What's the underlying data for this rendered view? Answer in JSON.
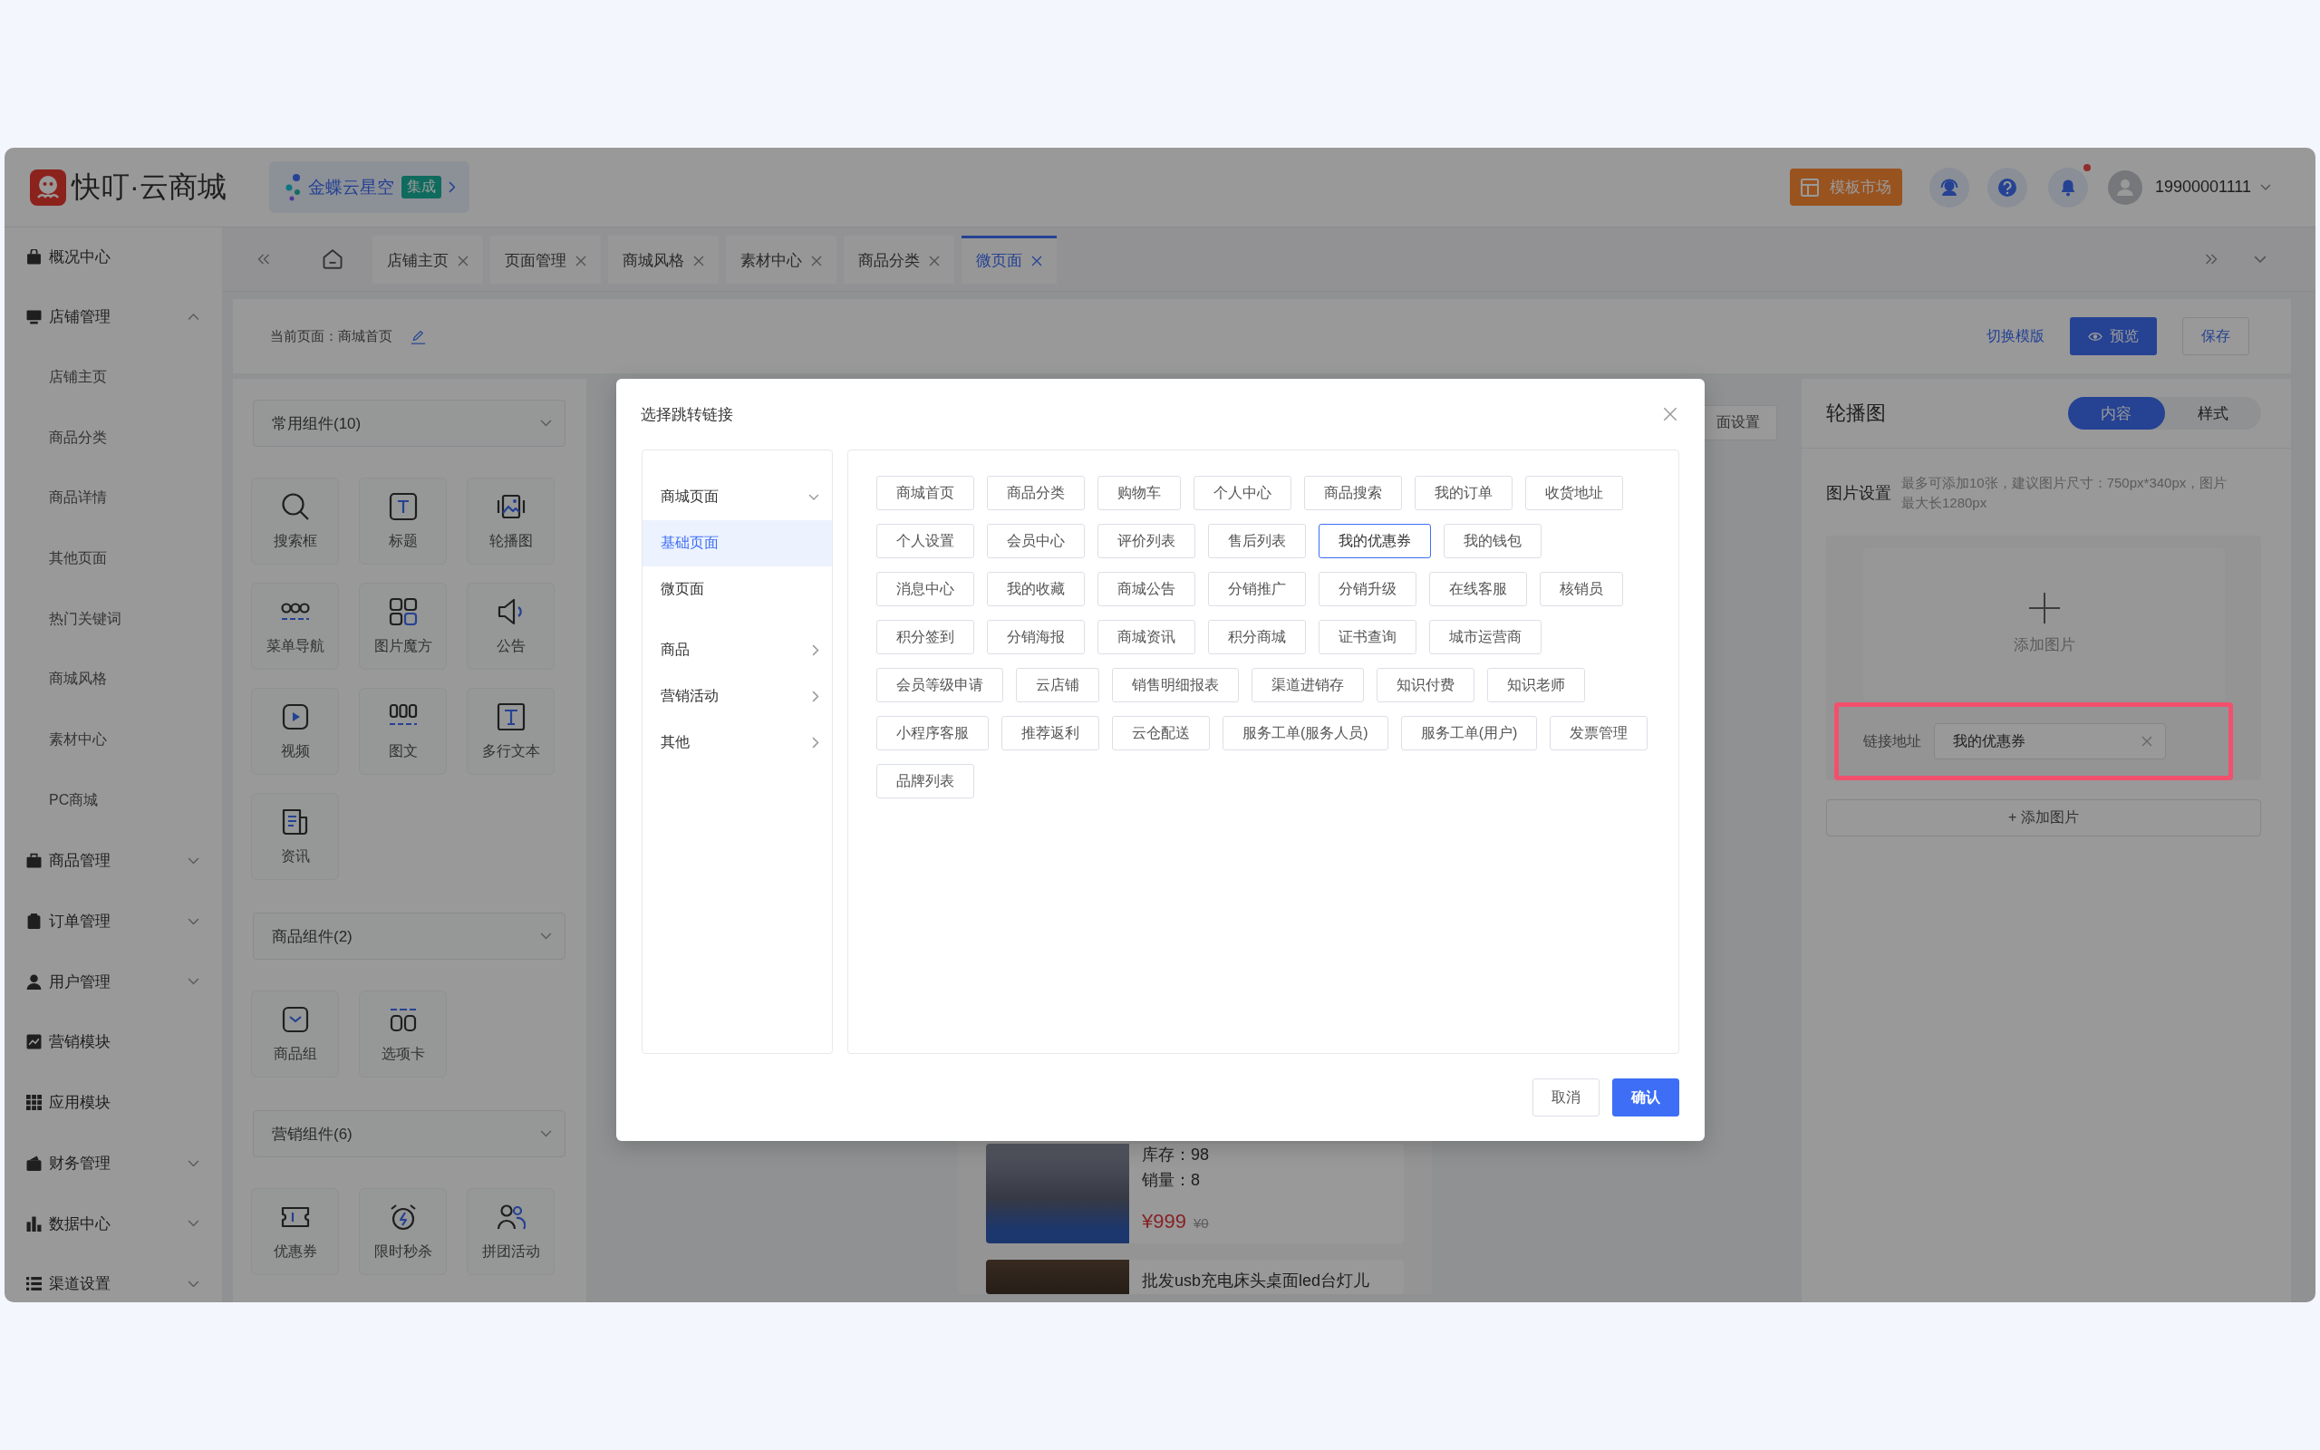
{
  "header": {
    "logo_text": "快叮·云商城",
    "integration": {
      "name": "金蝶云星空",
      "tag": "集成"
    },
    "template_market": "模板市场",
    "has_notification": true,
    "username": "19900001111"
  },
  "sidebar": {
    "items": [
      {
        "label": "概况中心",
        "kind": "link"
      },
      {
        "label": "店铺管理",
        "kind": "group",
        "expanded": true,
        "children": [
          {
            "label": "店铺主页"
          },
          {
            "label": "商品分类"
          },
          {
            "label": "商品详情"
          },
          {
            "label": "其他页面"
          },
          {
            "label": "热门关键词"
          },
          {
            "label": "商城风格"
          },
          {
            "label": "素材中心"
          },
          {
            "label": "PC商城"
          }
        ]
      },
      {
        "label": "商品管理",
        "kind": "group",
        "expanded": false
      },
      {
        "label": "订单管理",
        "kind": "group",
        "expanded": false
      },
      {
        "label": "用户管理",
        "kind": "group",
        "expanded": false
      },
      {
        "label": "营销模块",
        "kind": "link"
      },
      {
        "label": "应用模块",
        "kind": "link"
      },
      {
        "label": "财务管理",
        "kind": "group",
        "expanded": false
      },
      {
        "label": "数据中心",
        "kind": "group",
        "expanded": false
      },
      {
        "label": "渠道设置",
        "kind": "group",
        "expanded": false
      }
    ]
  },
  "tabs": [
    {
      "label": "店铺主页",
      "selected": false
    },
    {
      "label": "页面管理",
      "selected": false
    },
    {
      "label": "商城风格",
      "selected": false
    },
    {
      "label": "素材中心",
      "selected": false
    },
    {
      "label": "商品分类",
      "selected": false
    },
    {
      "label": "微页面",
      "selected": true
    }
  ],
  "toolbar": {
    "current_page": "当前页面：商城首页",
    "switch_template": "切换模版",
    "preview": "预览",
    "save": "保存"
  },
  "component_panel": {
    "sections": [
      {
        "title": "常用组件(10)",
        "items": [
          "搜索框",
          "标题",
          "轮播图",
          "菜单导航",
          "图片魔方",
          "公告",
          "视频",
          "图文",
          "多行文本",
          "资讯"
        ]
      },
      {
        "title": "商品组件(2)",
        "items": [
          "商品组",
          "选项卡"
        ]
      },
      {
        "title": "营销组件(6)",
        "items": [
          "优惠券",
          "限时秒杀",
          "拼团活动"
        ]
      }
    ]
  },
  "canvas": {
    "page_settings": "面设置",
    "products": [
      {
        "stock": "库存：98",
        "sales": "销量：8",
        "price": "¥999",
        "original_price": "¥0"
      },
      {
        "title": "批发usb充电床头桌面led台灯儿"
      }
    ]
  },
  "properties": {
    "title": "轮播图",
    "tabs": [
      {
        "label": "内容",
        "selected": true
      },
      {
        "label": "样式",
        "selected": false
      }
    ],
    "image_settings": {
      "label": "图片设置",
      "hint": "最多可添加10张，建议图片尺寸：750px*340px，图片最大长1280px"
    },
    "upload": {
      "label": "添加图片"
    },
    "link": {
      "label": "链接地址",
      "value": "我的优惠券",
      "highlighted": true
    },
    "add_button": "+ 添加图片"
  },
  "dialog": {
    "title": "选择跳转链接",
    "menu": [
      {
        "label": "商城页面",
        "expanded": true,
        "children": [
          {
            "label": "基础页面",
            "selected": true
          },
          {
            "label": "微页面",
            "selected": false
          }
        ]
      },
      {
        "label": "商品",
        "expanded": false
      },
      {
        "label": "营销活动",
        "expanded": false
      },
      {
        "label": "其他",
        "expanded": false
      }
    ],
    "link_rows": [
      [
        {
          "label": "商城首页",
          "selected": false
        },
        {
          "label": "商品分类",
          "selected": false
        },
        {
          "label": "购物车",
          "selected": false
        },
        {
          "label": "个人中心",
          "selected": false
        },
        {
          "label": "商品搜索",
          "selected": false
        },
        {
          "label": "我的订单",
          "selected": false
        },
        {
          "label": "收货地址",
          "selected": false
        }
      ],
      [
        {
          "label": "个人设置",
          "selected": false
        },
        {
          "label": "会员中心",
          "selected": false
        },
        {
          "label": "评价列表",
          "selected": false
        },
        {
          "label": "售后列表",
          "selected": false
        },
        {
          "label": "我的优惠券",
          "selected": true
        },
        {
          "label": "我的钱包",
          "selected": false
        }
      ],
      [
        {
          "label": "消息中心",
          "selected": false
        },
        {
          "label": "我的收藏",
          "selected": false
        },
        {
          "label": "商城公告",
          "selected": false
        },
        {
          "label": "分销推广",
          "selected": false
        },
        {
          "label": "分销升级",
          "selected": false
        },
        {
          "label": "在线客服",
          "selected": false
        },
        {
          "label": "核销员",
          "selected": false
        }
      ],
      [
        {
          "label": "积分签到",
          "selected": false
        },
        {
          "label": "分销海报",
          "selected": false
        },
        {
          "label": "商城资讯",
          "selected": false
        },
        {
          "label": "积分商城",
          "selected": false
        },
        {
          "label": "证书查询",
          "selected": false
        },
        {
          "label": "城市运营商",
          "selected": false
        }
      ],
      [
        {
          "label": "会员等级申请",
          "selected": false
        },
        {
          "label": "云店铺",
          "selected": false
        },
        {
          "label": "销售明细报表",
          "selected": false
        },
        {
          "label": "渠道进销存",
          "selected": false
        },
        {
          "label": "知识付费",
          "selected": false
        },
        {
          "label": "知识老师",
          "selected": false
        }
      ],
      [
        {
          "label": "小程序客服",
          "selected": false
        },
        {
          "label": "推荐返利",
          "selected": false
        },
        {
          "label": "云仓配送",
          "selected": false
        },
        {
          "label": "服务工单(服务人员)",
          "selected": false
        },
        {
          "label": "服务工单(用户)",
          "selected": false
        },
        {
          "label": "发票管理",
          "selected": false
        }
      ],
      [
        {
          "label": "品牌列表",
          "selected": false
        }
      ]
    ],
    "buttons": [
      {
        "label": "取消",
        "kind": "secondary"
      },
      {
        "label": "确认",
        "kind": "primary"
      }
    ]
  }
}
